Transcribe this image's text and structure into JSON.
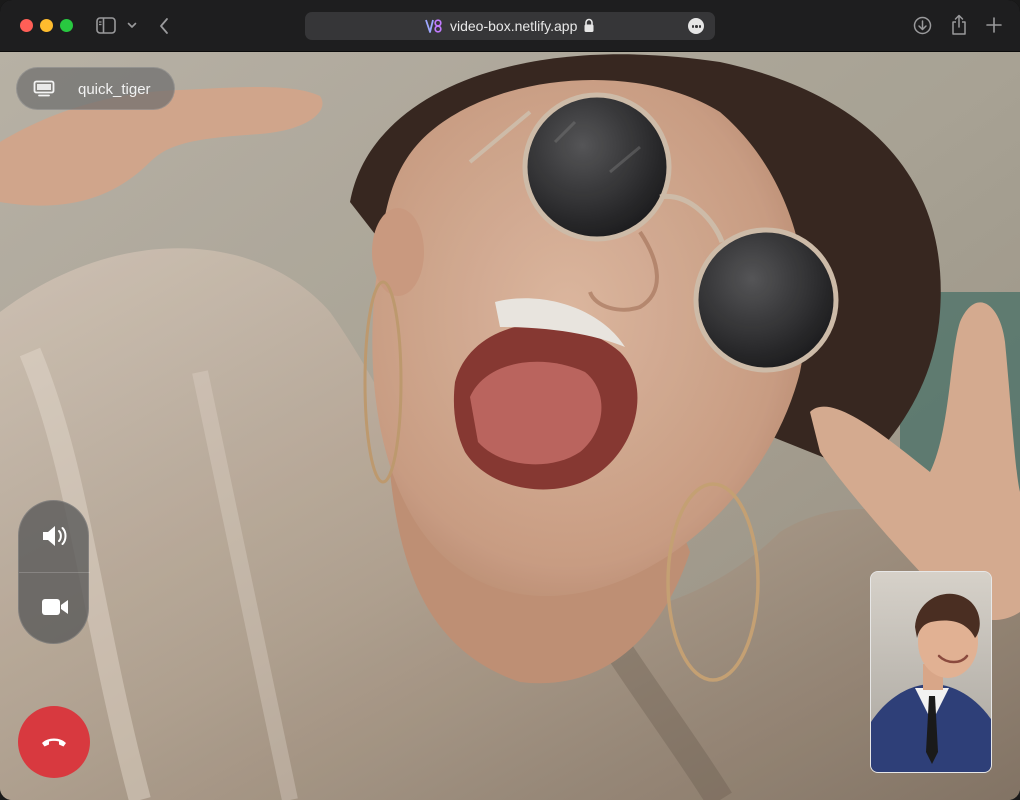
{
  "browser": {
    "url": "video-box.netlify.app",
    "icons": {
      "close": "traffic-light-close",
      "minimize": "traffic-light-minimize",
      "maximize": "traffic-light-maximize",
      "sidebar": "sidebar-icon",
      "sidebar_menu": "chevron-down-icon",
      "back": "chevron-left-icon",
      "site": "site-logo-icon",
      "lock": "lock-icon",
      "page_menu": "ellipsis-icon",
      "downloads": "download-icon",
      "share": "share-icon",
      "new_tab": "plus-icon"
    }
  },
  "call": {
    "remote_user": {
      "name": "quick_tiger",
      "icon": "screen-icon"
    },
    "controls": {
      "audio_icon": "speaker-icon",
      "video_icon": "video-camera-icon",
      "hangup_icon": "phone-hangup-icon"
    },
    "colors": {
      "hangup": "#d8393f",
      "pill_bg": "#6e6e6e"
    }
  }
}
